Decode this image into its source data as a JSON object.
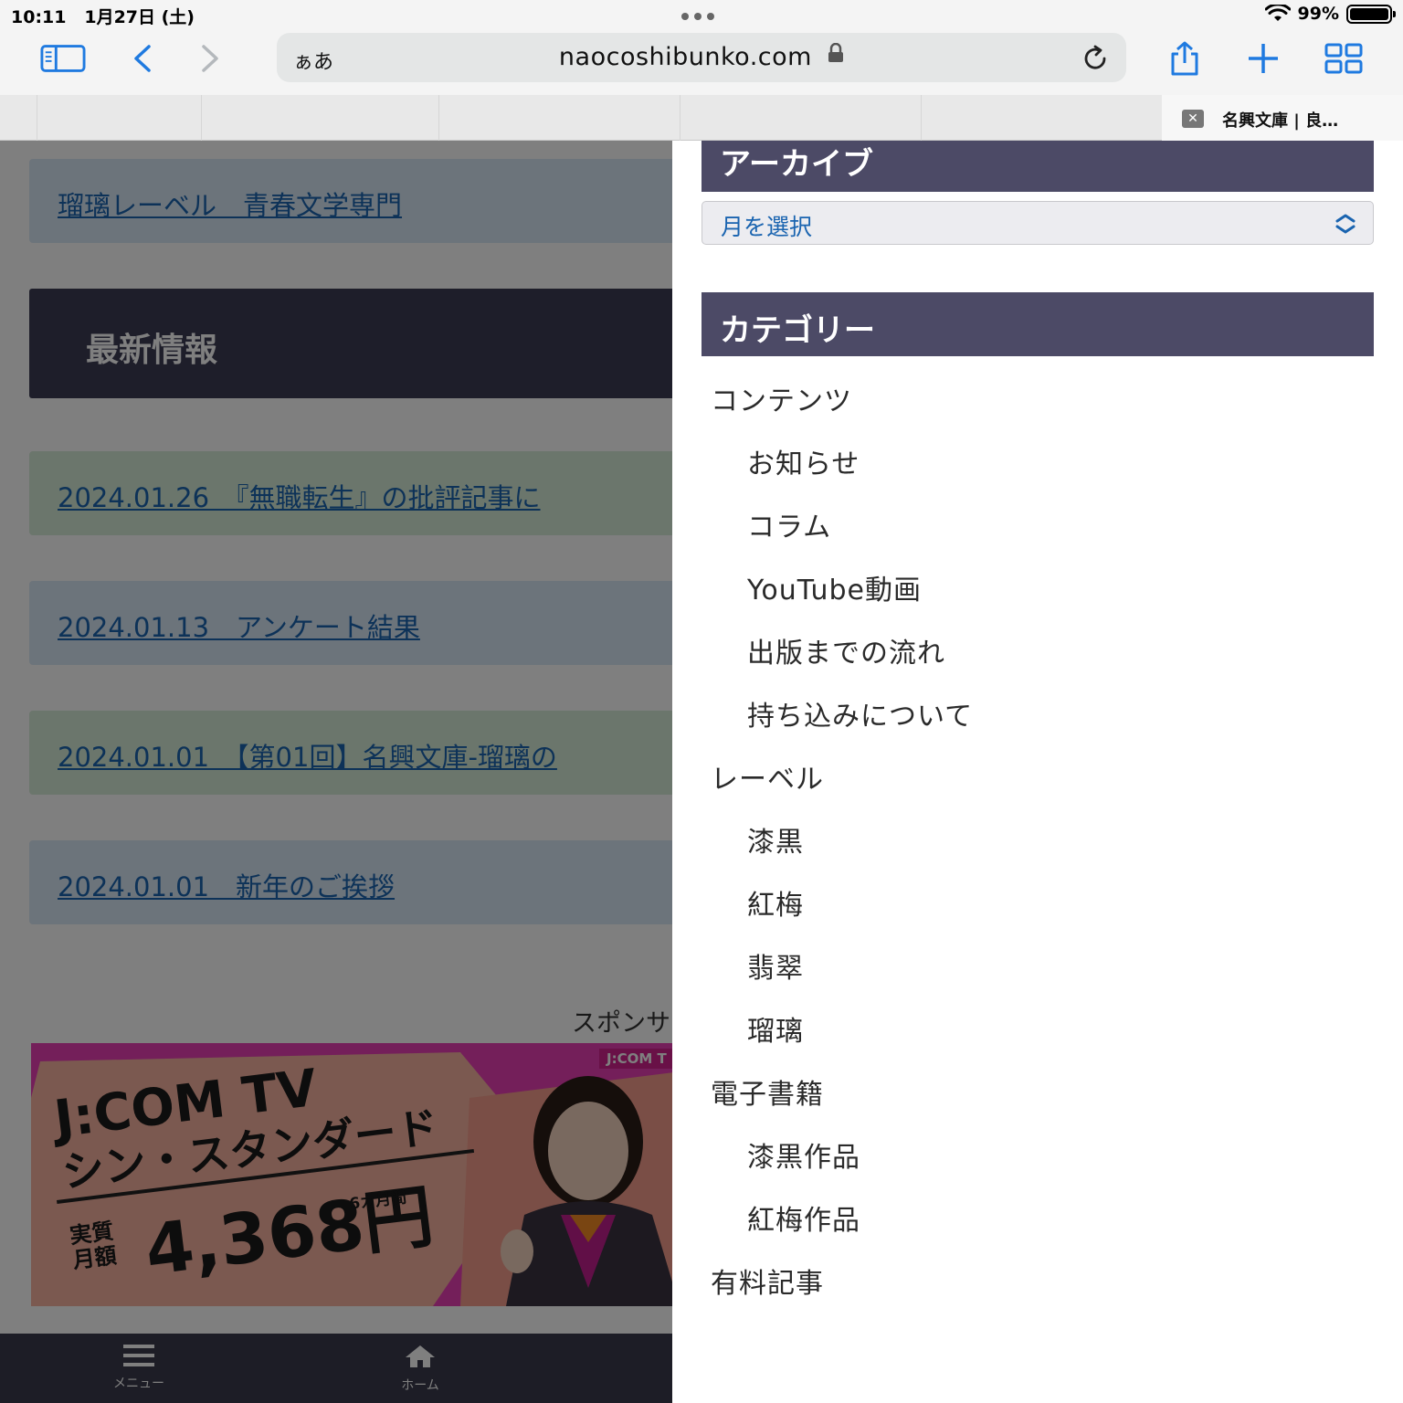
{
  "status_bar": {
    "time": "10:11",
    "date": "1月27日 (土)",
    "battery_percent": "99%",
    "battery_level": 0.99
  },
  "toolbar": {
    "aa_label": "ぁあ",
    "url": "naocoshibunko.com"
  },
  "tab": {
    "title": "名興文庫 | 良…",
    "close_label": "✕"
  },
  "page": {
    "label_link": "瑠璃レーベル　青春文学専門",
    "latest_heading": "最新情報",
    "news": [
      "2024.01.26　『無職転生』の批評記事に",
      "2024.01.13　アンケート結果",
      "2024.01.01　【第01回】名興文庫-瑠璃の",
      "2024.01.01　新年のご挨拶"
    ],
    "sponsor_label": "スポンサ",
    "ad": {
      "brand": "J:COM T",
      "line1": "J:COM TV",
      "line2": "シン・スタンダード",
      "small": "実質 月額",
      "price": "4,368円",
      "months": "6カ月間"
    }
  },
  "bottom_nav": {
    "menu": "メニュー",
    "home": "ホーム"
  },
  "drawer": {
    "archive_heading": "アーカイブ",
    "archive_select": "月を選択",
    "category_heading": "カテゴリー",
    "categories": [
      {
        "label": "コンテンツ",
        "level": 1
      },
      {
        "label": "お知らせ",
        "level": 2
      },
      {
        "label": "コラム",
        "level": 2
      },
      {
        "label": "YouTube動画",
        "level": 2
      },
      {
        "label": "出版までの流れ",
        "level": 2
      },
      {
        "label": "持ち込みについて",
        "level": 2
      },
      {
        "label": "レーベル",
        "level": 1
      },
      {
        "label": "漆黒",
        "level": 2
      },
      {
        "label": "紅梅",
        "level": 2
      },
      {
        "label": "翡翠",
        "level": 2
      },
      {
        "label": "瑠璃",
        "level": 2
      },
      {
        "label": "電子書籍",
        "level": 1
      },
      {
        "label": "漆黒作品",
        "level": 2
      },
      {
        "label": "紅梅作品",
        "level": 2
      },
      {
        "label": "有料記事",
        "level": 1
      }
    ]
  },
  "colors": {
    "accent_blue": "#1a64b0",
    "widget_header": "#4c4a66",
    "latest_header": "#3c3c54",
    "ad_pink": "#e93fb4"
  }
}
